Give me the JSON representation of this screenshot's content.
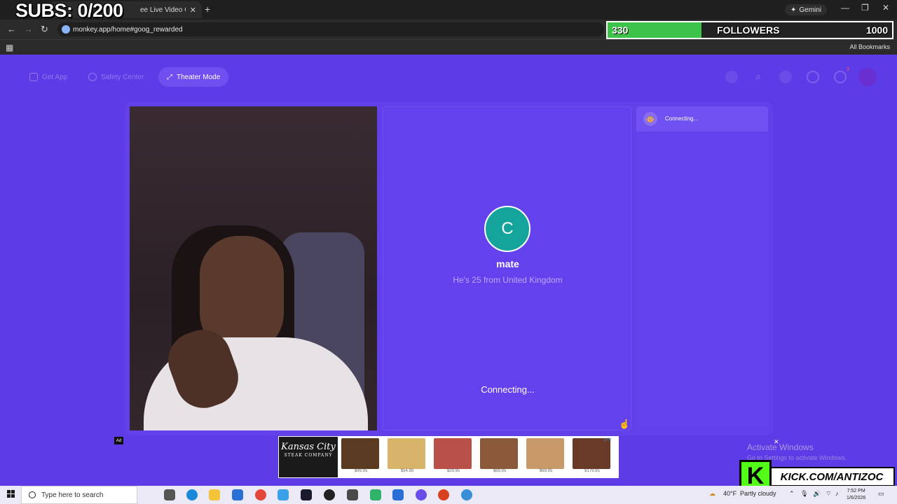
{
  "overlay": {
    "subs": "SUBS: 0/200",
    "followers_count": "330",
    "followers_label": "FOLLOWERS",
    "followers_goal": "1000",
    "followers_progress": 0.33,
    "kick_letter": "K",
    "kick_url": "KICK.COM/ANTIZOC"
  },
  "browser": {
    "tab_title": "ee Live Video Ch",
    "gemini_label": "Gemini",
    "url": "monkey.app/home#goog_rewarded",
    "all_bookmarks": "All Bookmarks"
  },
  "pagenav": {
    "get_app": "Get App",
    "safety_center": "Safety Center",
    "theater_mode": "Theater Mode",
    "notif_count": "3"
  },
  "match": {
    "avatar_letter": "C",
    "name": "mate",
    "info": "He's 25 from United Kingdom",
    "status": "Connecting..."
  },
  "chat": {
    "status": "Connecting..."
  },
  "ad": {
    "badge": "Ad",
    "brand_line1": "Kansas City",
    "brand_line2": "STEAK COMPANY",
    "items": [
      {
        "price": "$99.95",
        "color": "#5a3b22"
      },
      {
        "price": "$54.95",
        "color": "#d8b36a"
      },
      {
        "price": "$29.95",
        "color": "#b9504a"
      },
      {
        "price": "$69.95",
        "color": "#8a5a3a"
      },
      {
        "price": "$69.95",
        "color": "#c89a6a"
      },
      {
        "price": "$179.85",
        "color": "#6a3a28"
      }
    ]
  },
  "windows": {
    "activate_title": "Activate Windows",
    "activate_sub": "Go to Settings to activate Windows.",
    "search_placeholder": "Type here to search",
    "temp": "40°F",
    "weather": "Partly cloudy",
    "time": "7:52 PM",
    "date": "1/6/2026"
  }
}
